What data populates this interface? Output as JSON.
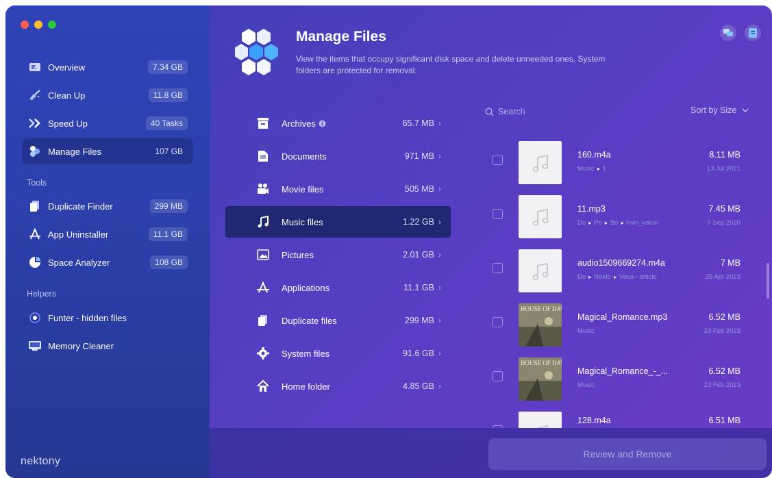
{
  "window": {
    "traffic_lights": [
      "close",
      "minimize",
      "zoom"
    ]
  },
  "sidebar": {
    "items": [
      {
        "label": "Overview",
        "value": "7.34 GB",
        "icon": "overview-icon"
      },
      {
        "label": "Clean Up",
        "value": "11.8 GB",
        "icon": "broom-icon"
      },
      {
        "label": "Speed Up",
        "value": "40 Tasks",
        "icon": "speed-chevron-icon"
      },
      {
        "label": "Manage Files",
        "value": "107 GB",
        "icon": "files-icon",
        "active": true
      }
    ],
    "tools_heading": "Tools",
    "tools": [
      {
        "label": "Duplicate Finder",
        "value": "299 MB",
        "icon": "duplicate-icon"
      },
      {
        "label": "App Uninstaller",
        "value": "11.1 GB",
        "icon": "uninstaller-icon"
      },
      {
        "label": "Space Analyzer",
        "value": "108 GB",
        "icon": "pie-chart-icon"
      }
    ],
    "helpers_heading": "Helpers",
    "helpers": [
      {
        "label": "Funter - hidden files",
        "icon": "eye-icon"
      },
      {
        "label": "Memory Cleaner",
        "icon": "memory-icon"
      }
    ],
    "brand": "nektony"
  },
  "header": {
    "title": "Manage Files",
    "description": "View the items that occupy significant disk space and delete unneeded ones. System folders are protected for removal."
  },
  "categories": [
    {
      "label": "Archives",
      "size": "65.7 MB",
      "icon": "archive-icon",
      "info": true
    },
    {
      "label": "Documents",
      "size": "971 MB",
      "icon": "document-icon"
    },
    {
      "label": "Movie files",
      "size": "505 MB",
      "icon": "movie-icon"
    },
    {
      "label": "Music files",
      "size": "1.22 GB",
      "icon": "music-icon",
      "active": true
    },
    {
      "label": "Pictures",
      "size": "2.01 GB",
      "icon": "picture-icon"
    },
    {
      "label": "Applications",
      "size": "11.1 GB",
      "icon": "applications-icon"
    },
    {
      "label": "Duplicate files",
      "size": "299 MB",
      "icon": "duplicate-files-icon"
    },
    {
      "label": "System files",
      "size": "91.6 GB",
      "icon": "gear-icon"
    },
    {
      "label": "Home folder",
      "size": "4.85 GB",
      "icon": "home-icon"
    }
  ],
  "list": {
    "search_placeholder": "Search",
    "sort_label": "Sort by Size",
    "items": [
      {
        "name": "160.m4a",
        "path": [
          "Music",
          "1"
        ],
        "size": "8.11 MB",
        "date": "13 Jul 2021",
        "thumb": "music-note"
      },
      {
        "name": "11.mp3",
        "path": [
          "Do",
          "Po",
          "Bo",
          "Irvin_valon"
        ],
        "size": "7.45 MB",
        "date": "7 Sep 2020",
        "thumb": "music-note"
      },
      {
        "name": "audio1509669274.m4a",
        "path": [
          "Do",
          "Nekto",
          "Vova - article"
        ],
        "size": "7 MB",
        "date": "25 Apr 2023",
        "thumb": "music-note"
      },
      {
        "name": "Magical_Romance.mp3",
        "path": [
          "Music"
        ],
        "size": "6.52 MB",
        "date": "23 Feb 2023",
        "thumb": "album-cover",
        "cover_text": "HOUSE OF DAWN"
      },
      {
        "name": "Magical_Romance_-_...",
        "path": [
          "Music"
        ],
        "size": "6.52 MB",
        "date": "23 Feb 2023",
        "thumb": "album-cover",
        "cover_text": "HOUSE OF DAWN"
      },
      {
        "name": "128.m4a",
        "path": [],
        "size": "6.51 MB",
        "date": "",
        "thumb": "music-note"
      }
    ]
  },
  "footer": {
    "review_button": "Review and Remove"
  }
}
